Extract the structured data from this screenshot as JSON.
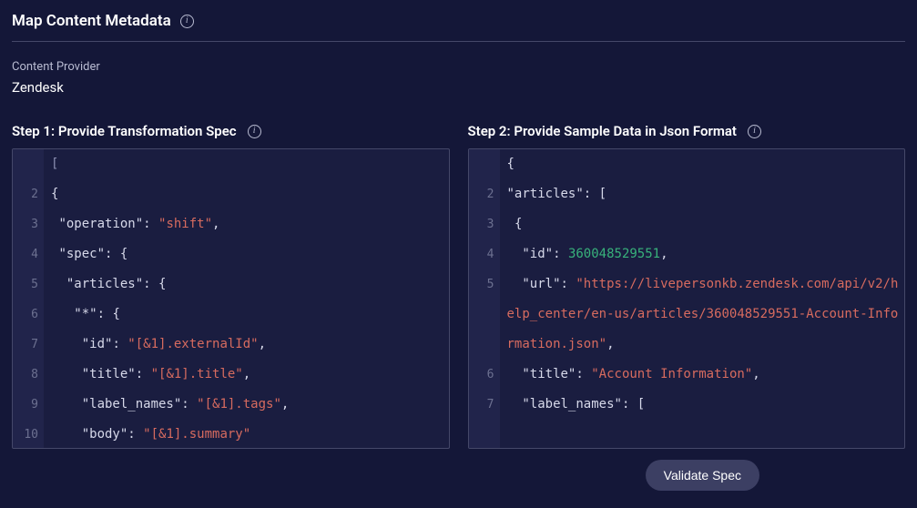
{
  "header": {
    "title": "Map Content Metadata"
  },
  "provider": {
    "label": "Content Provider",
    "value": "Zendesk"
  },
  "step1": {
    "title": "Step 1: Provide Transformation Spec",
    "lines": [
      {
        "num": "",
        "tokens": [
          {
            "t": "[",
            "c": "cursor"
          }
        ]
      },
      {
        "num": "2",
        "tokens": [
          {
            "t": "{",
            "c": "punct"
          }
        ]
      },
      {
        "num": "3",
        "tokens": [
          {
            "t": " ",
            "c": "punct"
          },
          {
            "t": "\"operation\"",
            "c": "punct"
          },
          {
            "t": ": ",
            "c": "punct"
          },
          {
            "t": "\"shift\"",
            "c": "str"
          },
          {
            "t": ",",
            "c": "punct"
          }
        ]
      },
      {
        "num": "4",
        "tokens": [
          {
            "t": " ",
            "c": "punct"
          },
          {
            "t": "\"spec\"",
            "c": "punct"
          },
          {
            "t": ": {",
            "c": "punct"
          }
        ]
      },
      {
        "num": "5",
        "tokens": [
          {
            "t": "  ",
            "c": "punct"
          },
          {
            "t": "\"articles\"",
            "c": "punct"
          },
          {
            "t": ": {",
            "c": "punct"
          }
        ]
      },
      {
        "num": "6",
        "tokens": [
          {
            "t": "   ",
            "c": "punct"
          },
          {
            "t": "\"*\"",
            "c": "punct"
          },
          {
            "t": ": {",
            "c": "punct"
          }
        ]
      },
      {
        "num": "7",
        "tokens": [
          {
            "t": "    ",
            "c": "punct"
          },
          {
            "t": "\"id\"",
            "c": "punct"
          },
          {
            "t": ": ",
            "c": "punct"
          },
          {
            "t": "\"[&1].externalId\"",
            "c": "str"
          },
          {
            "t": ",",
            "c": "punct"
          }
        ]
      },
      {
        "num": "8",
        "tokens": [
          {
            "t": "    ",
            "c": "punct"
          },
          {
            "t": "\"title\"",
            "c": "punct"
          },
          {
            "t": ": ",
            "c": "punct"
          },
          {
            "t": "\"[&1].title\"",
            "c": "str"
          },
          {
            "t": ",",
            "c": "punct"
          }
        ]
      },
      {
        "num": "9",
        "tokens": [
          {
            "t": "    ",
            "c": "punct"
          },
          {
            "t": "\"label_names\"",
            "c": "punct"
          },
          {
            "t": ": ",
            "c": "punct"
          },
          {
            "t": "\"[&1].tags\"",
            "c": "str"
          },
          {
            "t": ",",
            "c": "punct"
          }
        ]
      },
      {
        "num": "10",
        "tokens": [
          {
            "t": "    ",
            "c": "punct"
          },
          {
            "t": "\"body\"",
            "c": "punct"
          },
          {
            "t": ": ",
            "c": "punct"
          },
          {
            "t": "\"[&1].summary\"",
            "c": "str"
          }
        ]
      }
    ]
  },
  "step2": {
    "title": "Step 2: Provide Sample Data in Json Format",
    "lines": [
      {
        "num": "",
        "tall": 1,
        "tokens": [
          {
            "t": "{",
            "c": "punct"
          }
        ]
      },
      {
        "num": "2",
        "tall": 1,
        "tokens": [
          {
            "t": "\"articles\"",
            "c": "punct"
          },
          {
            "t": ": [",
            "c": "punct"
          }
        ]
      },
      {
        "num": "3",
        "tall": 1,
        "tokens": [
          {
            "t": " {",
            "c": "punct"
          }
        ]
      },
      {
        "num": "4",
        "tall": 1,
        "tokens": [
          {
            "t": "  ",
            "c": "punct"
          },
          {
            "t": "\"id\"",
            "c": "punct"
          },
          {
            "t": ": ",
            "c": "punct"
          },
          {
            "t": "360048529551",
            "c": "num"
          },
          {
            "t": ",",
            "c": "punct"
          }
        ]
      },
      {
        "num": "5",
        "tall": 3,
        "tokens": [
          {
            "t": "  ",
            "c": "punct"
          },
          {
            "t": "\"url\"",
            "c": "punct"
          },
          {
            "t": ": ",
            "c": "punct"
          },
          {
            "t": "\"https://livepersonkb.zendesk.com/api/v2/help_center/en-us/articles/360048529551-Account-Information.json\"",
            "c": "str"
          },
          {
            "t": ",",
            "c": "punct"
          }
        ]
      },
      {
        "num": "6",
        "tall": 1,
        "tokens": [
          {
            "t": "  ",
            "c": "punct"
          },
          {
            "t": "\"title\"",
            "c": "punct"
          },
          {
            "t": ": ",
            "c": "punct"
          },
          {
            "t": "\"Account Information\"",
            "c": "str"
          },
          {
            "t": ",",
            "c": "punct"
          }
        ]
      },
      {
        "num": "7",
        "tall": 1,
        "tokens": [
          {
            "t": "  ",
            "c": "punct"
          },
          {
            "t": "\"label_names\"",
            "c": "punct"
          },
          {
            "t": ": [",
            "c": "punct"
          }
        ]
      }
    ]
  },
  "footer": {
    "validate_label": "Validate Spec"
  }
}
